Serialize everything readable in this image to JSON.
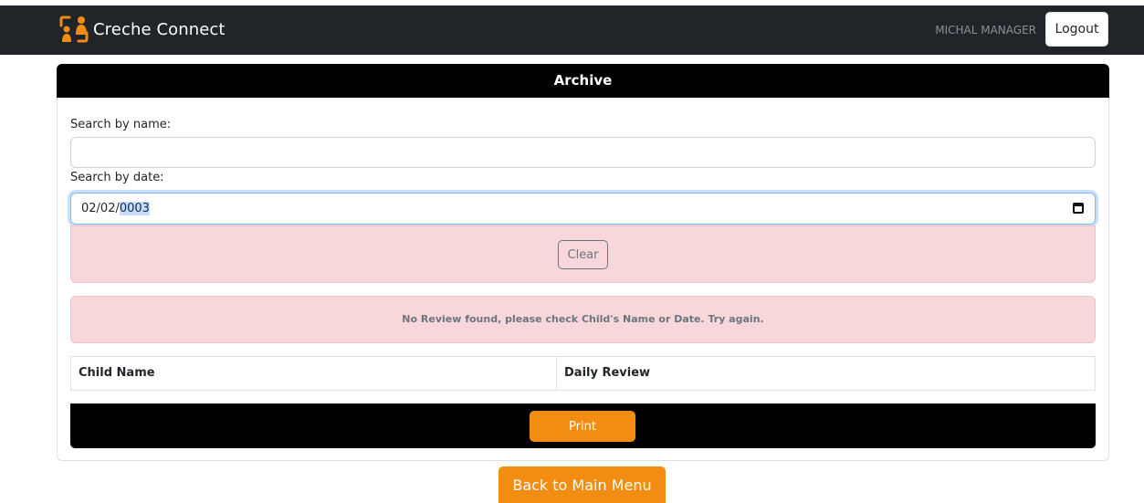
{
  "navbar": {
    "brand_name": "Creche Connect",
    "user_name": "MICHAL MANAGER",
    "logout_label": "Logout"
  },
  "archive": {
    "title": "Archive",
    "search_name_label": "Search by name:",
    "search_name_value": "",
    "search_date_label": "Search by date:",
    "search_date_value_prefix": "02/02/",
    "search_date_value_selected": "0003",
    "clear_label": "Clear",
    "message": "No Review found, please check Child's Name or Date. Try again.",
    "table": {
      "columns": [
        "Child Name",
        "Daily Review"
      ]
    },
    "print_label": "Print"
  },
  "footer": {
    "back_label": "Back to Main Menu"
  },
  "colors": {
    "navbar_bg": "#212529",
    "accent_orange": "#f28c13",
    "alert_bg": "#f8d7da",
    "header_bg": "#000000"
  }
}
